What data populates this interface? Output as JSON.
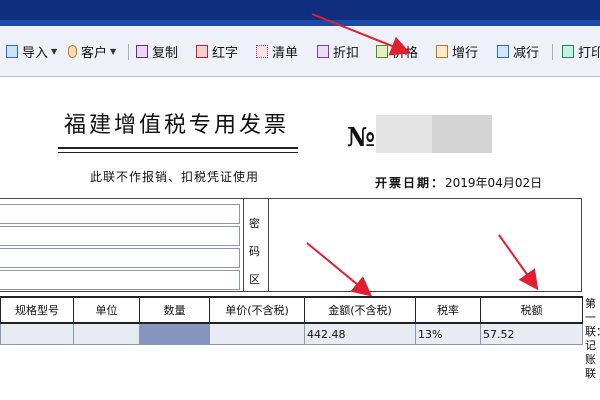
{
  "toolbar": {
    "items": [
      {
        "label": "导入",
        "icon": "import-icon",
        "has_dropdown": true
      },
      {
        "label": "客户",
        "icon": "customer-icon",
        "has_dropdown": true
      },
      {
        "label": "复制",
        "icon": "copy-icon",
        "has_dropdown": false
      },
      {
        "label": "红字",
        "icon": "red-invoice-icon",
        "has_dropdown": false
      },
      {
        "label": "清单",
        "icon": "list-icon",
        "has_dropdown": false
      },
      {
        "label": "折扣",
        "icon": "discount-icon",
        "has_dropdown": false
      },
      {
        "label": "价格",
        "icon": "price-icon",
        "has_dropdown": false
      },
      {
        "label": "增行",
        "icon": "add-row-icon",
        "has_dropdown": false
      },
      {
        "label": "减行",
        "icon": "delete-row-icon",
        "has_dropdown": false
      },
      {
        "label": "打印",
        "icon": "print-icon",
        "has_dropdown": false
      }
    ]
  },
  "invoice": {
    "title": "福建增值税专用发票",
    "number_prefix": "№",
    "subtitle": "此联不作报销、扣税凭证使用",
    "date_label": "开票日期：",
    "date_value": "2019年04月02日",
    "mima_chars": [
      "密",
      "码",
      "区"
    ],
    "copy_label": "第一联：记账联"
  },
  "items_table": {
    "columns": [
      "规格型号",
      "单位",
      "数量",
      "单价(不含税)",
      "金额(不含税)",
      "税率",
      "税额"
    ],
    "rows": [
      {
        "spec": "",
        "unit": "",
        "qty": "",
        "unit_price": "",
        "amount": "442.48",
        "tax_rate": "13%",
        "tax": "57.52"
      }
    ]
  },
  "colors": {
    "title_bar": "#0f2f7e",
    "annotation_arrow": "#e02030",
    "selected_cell": "#8595c0"
  }
}
